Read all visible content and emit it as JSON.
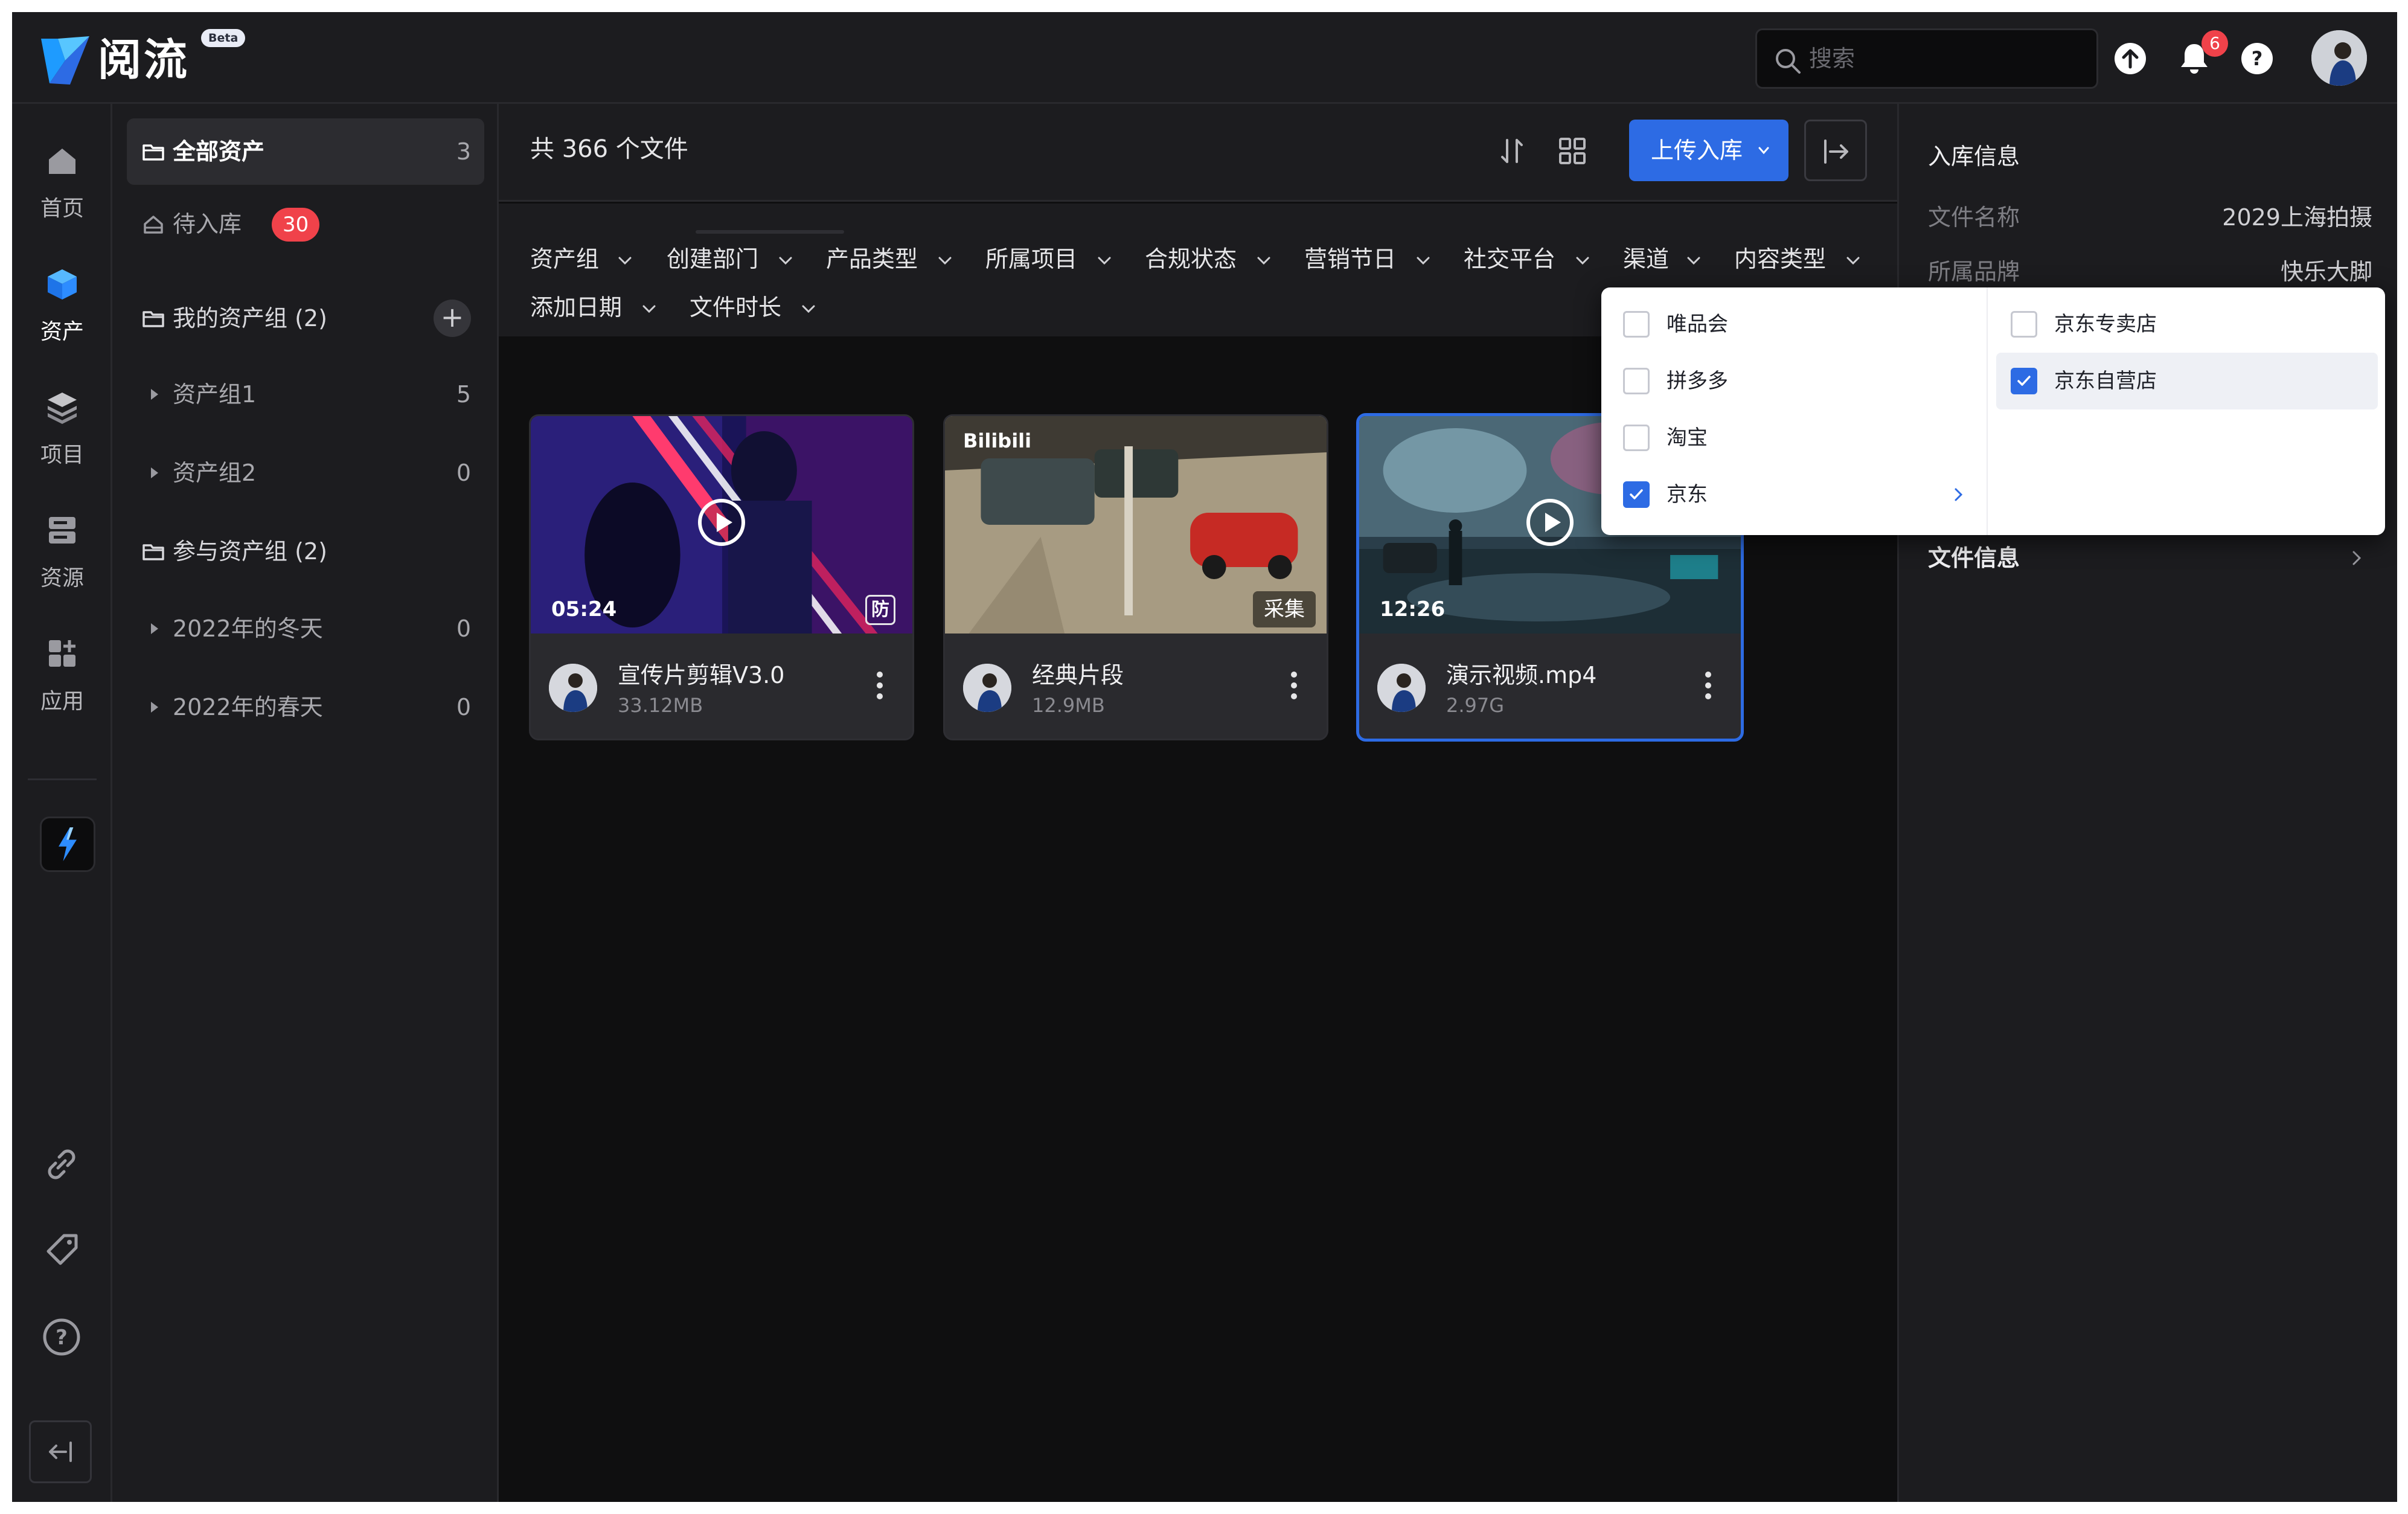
{
  "app": {
    "name": "阅流",
    "beta": "Beta"
  },
  "topbar": {
    "search_placeholder": "搜索",
    "notification_count": "6"
  },
  "rail": {
    "items": [
      {
        "label": "首页",
        "icon": "home-icon"
      },
      {
        "label": "资产",
        "icon": "asset-cube-icon"
      },
      {
        "label": "项目",
        "icon": "layers-icon"
      },
      {
        "label": "资源",
        "icon": "resource-icon"
      },
      {
        "label": "应用",
        "icon": "apps-icon"
      }
    ],
    "active": "资产"
  },
  "sidebar": {
    "all_assets": {
      "label": "全部资产",
      "count": "3"
    },
    "pending": {
      "label": "待入库",
      "count": "30"
    },
    "my_groups": {
      "label": "我的资产组 (2)"
    },
    "my_group_items": [
      {
        "label": "资产组1",
        "count": "5"
      },
      {
        "label": "资产组2",
        "count": "0"
      }
    ],
    "joined_groups": {
      "label": "参与资产组 (2)"
    },
    "joined_group_items": [
      {
        "label": "2022年的冬天",
        "count": "0"
      },
      {
        "label": "2022年的春天",
        "count": "0"
      }
    ]
  },
  "main": {
    "file_count": "共 366 个文件",
    "upload_label": "上传入库",
    "filters": [
      "资产组",
      "创建部门",
      "产品类型",
      "所属项目",
      "合规状态",
      "营销节日",
      "社交平台",
      "渠道",
      "内容类型",
      "添加日期",
      "文件时长"
    ],
    "cards": [
      {
        "title": "宣传片剪辑V3.0",
        "size": "33.12MB",
        "duration": "05:24",
        "tag": "防",
        "selected": false
      },
      {
        "title": "经典片段",
        "size": "12.9MB",
        "watermark": "Bilibili",
        "tag": "采集",
        "selected": false
      },
      {
        "title": "演示视频.mp4",
        "size": "2.97G",
        "duration": "12:26",
        "selected": true
      }
    ]
  },
  "right_panel": {
    "section_title": "入库信息",
    "rows": [
      {
        "key": "文件名称",
        "value": "2029上海拍摄"
      },
      {
        "key": "所属品牌",
        "value": "快乐大脚"
      }
    ],
    "file_info": "文件信息"
  },
  "channel_dropdown": {
    "level1": [
      {
        "label": "唯品会",
        "checked": false
      },
      {
        "label": "拼多多",
        "checked": false
      },
      {
        "label": "淘宝",
        "checked": false
      },
      {
        "label": "京东",
        "checked": true,
        "has_children": true
      }
    ],
    "level2": [
      {
        "label": "京东专卖店",
        "checked": false
      },
      {
        "label": "京东自营店",
        "checked": true
      }
    ]
  },
  "colors": {
    "accent": "#2d6be4",
    "badge": "#f0424a",
    "background": "#0f0f10",
    "panel": "#1c1c1f"
  }
}
